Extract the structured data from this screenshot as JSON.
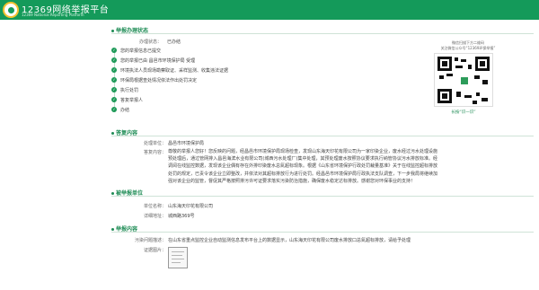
{
  "header": {
    "title": "12369网络举报平台",
    "subtitle": "12369 National Reporting Platform"
  },
  "progress": {
    "section_title": "举报办理状态",
    "status_label": "办理状态：",
    "status_value": "已办结",
    "steps": [
      "您的举报信息已提交",
      "您的举报已由 昌邑市环境保护局 受理",
      "环境执法人员现场勘察取证、采样监测、收集违法证据",
      "环保局根据查处情况依法作出处罚决定",
      "执行处罚",
      "答复举报人",
      "办结"
    ]
  },
  "qr_panel": {
    "caption_line1": "微信扫描下方二维码",
    "caption_line2": "关注微信公众号“12369环保举报”",
    "tip": "长按“识一识”"
  },
  "reply": {
    "section_title": "答复内容",
    "unit_label": "处理单位：",
    "unit_value": "昌邑市环境保护局",
    "content_label": "答复内容：",
    "content_value": "尊敬的举报人您好！您反映的问题，经昌邑市环境保护局现场检查，发现山东海天印花有限公司为一家印染企业，废水经过污水处理设施预处理后，通过管网排入昌邑海滨水业有限公司(城西污水处理厂)集中处理，其预处理废水按照协议要求执行纳管协议污水排放标准。经调阅在线监控数据，发现该企业偶有存在外排印染废水总氮超标现象。根据《山东省环境保护行政处罚裁量基准》关于在线监控超标排放处罚的规定，已责令该企业立即整改，并依法对其超标排放行为进行处罚。经昌邑市环境保护局行政执法支队调查，下一步我局将继续加强对该企业的监管，督促其严格按照排污许可证要求落实污染防治措施，确保废水稳定达标排放。感谢您对环保事业的支持！"
  },
  "reported": {
    "section_title": "被举报单位",
    "name_label": "单位名称：",
    "name_value": "山东海天印花有限公司",
    "address_label": "详细地址：",
    "address_value": "城西路369号"
  },
  "report": {
    "section_title": "举报内容",
    "desc_label": "污染问题描述：",
    "desc_value": "在山东省重点监控企业自动监测信息发布平台上的数据显示，山东海天印花有限公司废水排放口总氮超标排放，请给予处理",
    "evidence_label": "证据图片："
  }
}
